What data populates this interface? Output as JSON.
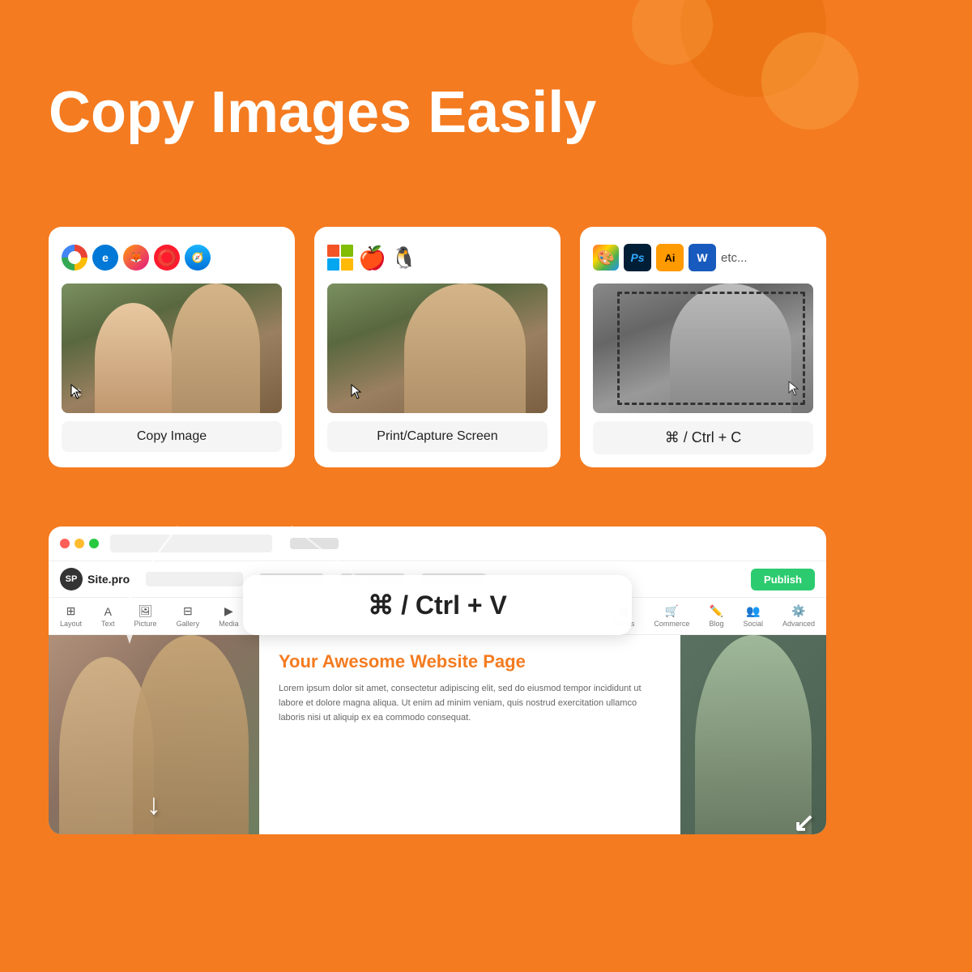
{
  "page": {
    "background_color": "#F47B20",
    "title": "Copy Images Easily"
  },
  "cards": [
    {
      "id": "browser-card",
      "icons": [
        "Chrome",
        "Edge",
        "Firefox",
        "Opera",
        "Safari"
      ],
      "label": "Copy Image",
      "has_cursor": true
    },
    {
      "id": "os-card",
      "icons": [
        "Windows",
        "Apple",
        "Linux"
      ],
      "label": "Print/Capture Screen",
      "has_cursor": true
    },
    {
      "id": "app-card",
      "icons": [
        "Paint",
        "Photoshop",
        "Illustrator",
        "Word"
      ],
      "etc_label": "etc...",
      "label": "⌘ / Ctrl + C",
      "has_selection": true,
      "has_cursor": true
    }
  ],
  "shortcut_paste": "⌘ / Ctrl + V",
  "bottom_card": {
    "site_name": "Site.pro",
    "publish_label": "Publish",
    "toolbar_items": [
      "Layout",
      "Text",
      "Picture",
      "Gallery",
      "Media"
    ],
    "toolbar_items_right": [
      "Blocks",
      "Commerce",
      "Blog",
      "Social",
      "Advanced"
    ],
    "content_title": "Your Awesome Website Page",
    "content_text": "Lorem ipsum dolor sit amet, consectetur adipiscing elit, sed do eiusmod tempor incididunt ut labore et dolore magna aliqua. Ut enim ad minim veniam, quis nostrud exercitation ullamco laboris nisi ut aliquip ex ea commodo consequat."
  }
}
